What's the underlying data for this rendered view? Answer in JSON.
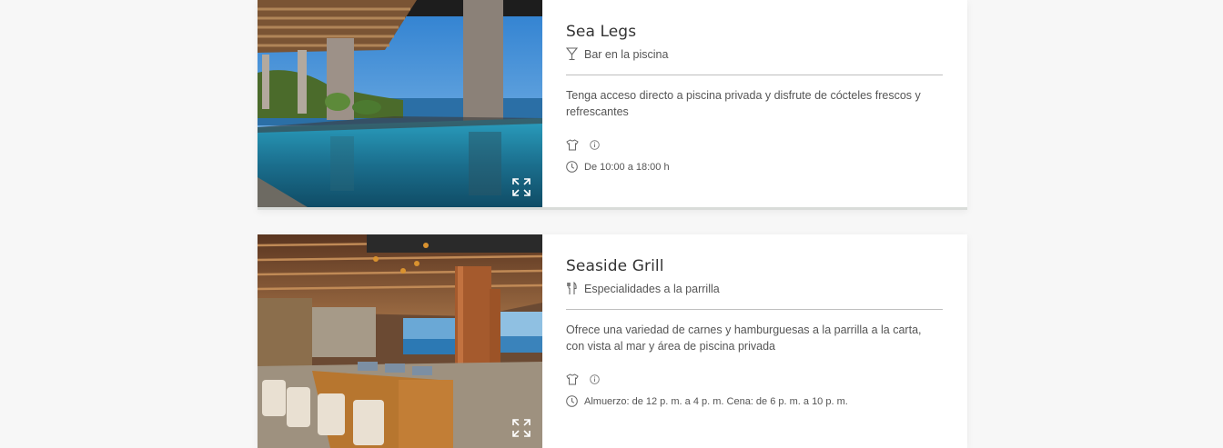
{
  "venues": [
    {
      "name": "Sea Legs",
      "type": "Bar en la piscina",
      "type_icon": "cocktail-glass-icon",
      "description": "Tenga acceso directo a piscina privada y disfrute de cócteles frescos y refrescantes",
      "dress_code_icon": "shirt-icon",
      "info_icon": "info-icon",
      "hours": "De 10:00 a 18:00 h",
      "photo_subject": "infinity pool with ocean view under wooden pergola"
    },
    {
      "name": "Seaside Grill",
      "type": "Especialidades a la parrilla",
      "type_icon": "fork-knife-icon",
      "description": "Ofrece una variedad de carnes y hamburguesas a la parrilla a la carta, con vista al mar y área de piscina privada",
      "dress_code_icon": "shirt-icon",
      "info_icon": "info-icon",
      "hours": "Almuerzo: de 12 p. m. a 4 p. m. Cena: de 6 p. m. a 10 p. m.",
      "photo_subject": "open-air restaurant with wooden tables and ocean view"
    }
  ],
  "colors": {
    "background": "#f7f7f7",
    "card": "#ffffff",
    "divider": "#bfbfbf",
    "text": "#555555"
  }
}
